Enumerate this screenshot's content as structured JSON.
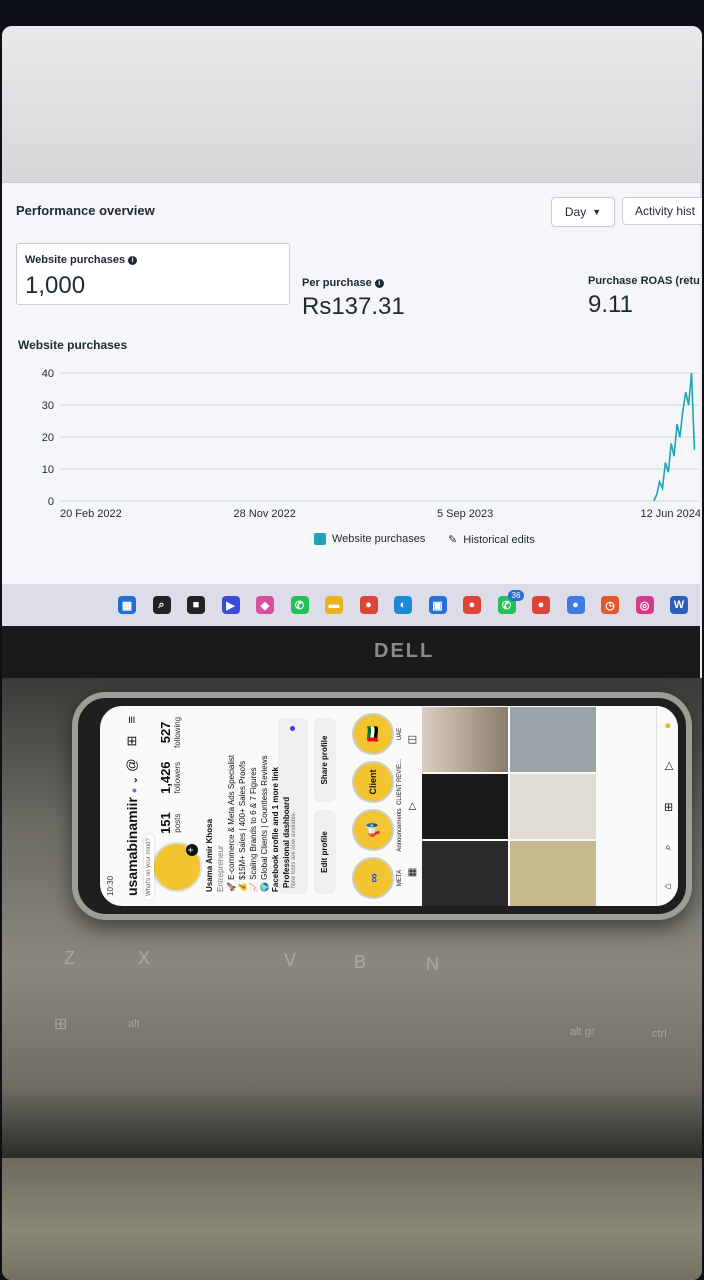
{
  "dashboard": {
    "title": "Performance overview",
    "day_button": "Day",
    "activity_button": "Activity hist",
    "metrics": [
      {
        "label": "Website purchases",
        "value": "1,000"
      },
      {
        "label": "Per purchase",
        "value": "Rs137.31"
      },
      {
        "label": "Purchase ROAS (retu",
        "value": "9.11"
      }
    ],
    "chart_title": "Website purchases",
    "legend": {
      "series": "Website purchases",
      "edits": "Historical edits"
    }
  },
  "chart_data": {
    "type": "line",
    "title": "Website purchases",
    "x_ticks": [
      "20 Feb 2022",
      "28 Nov 2022",
      "5 Sep 2023",
      "12 Jun 2024"
    ],
    "y_ticks": [
      "0",
      "10",
      "20",
      "30",
      "40"
    ],
    "ylim": [
      0,
      40
    ],
    "grid": true,
    "series": [
      {
        "name": "Website purchases",
        "color": "#1fa3b7",
        "x": [
          "2024-05-20",
          "2024-05-24",
          "2024-05-28",
          "2024-06-01",
          "2024-06-05",
          "2024-06-09",
          "2024-06-13",
          "2024-06-17",
          "2024-06-21",
          "2024-06-25",
          "2024-06-29",
          "2024-07-03",
          "2024-07-07",
          "2024-07-11",
          "2024-07-15"
        ],
        "values": [
          0,
          2,
          6,
          4,
          12,
          9,
          18,
          14,
          24,
          20,
          28,
          34,
          30,
          40,
          16
        ]
      }
    ]
  },
  "taskbar": {
    "icons": [
      {
        "name": "windows-start-icon",
        "color": "#1f6fd1",
        "glyph": "▦"
      },
      {
        "name": "search-icon",
        "color": "#222",
        "glyph": "⌕"
      },
      {
        "name": "task-view-icon",
        "color": "#222",
        "glyph": "■"
      },
      {
        "name": "meet-icon",
        "color": "#3b4dd8",
        "glyph": "▶"
      },
      {
        "name": "copilot-icon",
        "color": "#d94fa0",
        "glyph": "◆"
      },
      {
        "name": "whatsapp-icon",
        "color": "#25c05a",
        "glyph": "✆"
      },
      {
        "name": "file-explorer-icon",
        "color": "#e8b41c",
        "glyph": "▬"
      },
      {
        "name": "chrome-icon",
        "color": "#db4437",
        "glyph": "●"
      },
      {
        "name": "edge-icon",
        "color": "#1e8ad6",
        "glyph": "◐"
      },
      {
        "name": "store-icon",
        "color": "#2a6fd6",
        "glyph": "▣"
      },
      {
        "name": "chrome-icon-2",
        "color": "#db4437",
        "glyph": "●"
      },
      {
        "name": "whatsapp-icon-2",
        "color": "#25c05a",
        "glyph": "✆"
      },
      {
        "name": "chrome-icon-3",
        "color": "#db4437",
        "glyph": "●"
      },
      {
        "name": "chrome-icon-4",
        "color": "#3d7be0",
        "glyph": "●"
      },
      {
        "name": "clock-icon",
        "color": "#e2582b",
        "glyph": "◷"
      },
      {
        "name": "instagram-icon",
        "color": "#d43a8a",
        "glyph": "◎"
      },
      {
        "name": "word-icon",
        "color": "#2b5fb8",
        "glyph": "W"
      }
    ],
    "badge": "36"
  },
  "laptop": {
    "brand": "DELL",
    "keys": [
      "Z",
      "X",
      "V",
      "B",
      "N",
      "alt",
      "alt gr",
      "ctrl"
    ]
  },
  "phone": {
    "time": "10:30",
    "username": "usamabinamiir",
    "bubble": "What's on your mind?",
    "stats": [
      {
        "value": "151",
        "label": "posts"
      },
      {
        "value": "1,426",
        "label": "followers"
      },
      {
        "value": "527",
        "label": "following"
      }
    ],
    "bio": {
      "name": "Usama Amir Khosa",
      "category": "Entrepreneur",
      "lines": [
        "🚀 E-commerce & Meta Ads Specialist",
        "💰 $15M+ Sales | 400+ Sales Proofs",
        "📈 Scaling Brands to 6 & 7 Figures",
        "🌍 Global Clients | Countless Reviews",
        "Facebook profile and 1 more link"
      ]
    },
    "dashboard": {
      "title": "Professional dashboard",
      "sub": "New tools are now available."
    },
    "buttons": {
      "edit": "Edit profile",
      "share": "Share profile"
    },
    "highlights": [
      {
        "label": "META",
        "glyph": "∞"
      },
      {
        "label": "Announcements",
        "glyph": "📢"
      },
      {
        "label": "CLIENT REVIE...",
        "glyph": "Client"
      },
      {
        "label": "UAE",
        "glyph": "🇦🇪"
      }
    ]
  }
}
